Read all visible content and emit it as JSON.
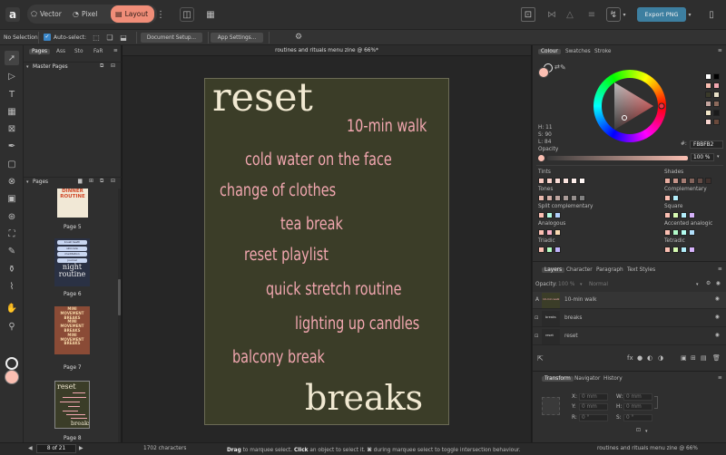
{
  "app": {
    "logo_letter": "a"
  },
  "personas": [
    {
      "label": "Vector",
      "active": false
    },
    {
      "label": "Pixel",
      "active": false
    },
    {
      "label": "Layout",
      "active": true
    }
  ],
  "export_label": "Export PNG",
  "context": {
    "selection": "No Selection",
    "auto_select": "Auto-select:",
    "document_setup": "Document Setup...",
    "app_settings": "App Settings..."
  },
  "left_panel": {
    "tabs": [
      "Pages",
      "Ass",
      "Sto",
      "FaR"
    ],
    "master_pages_title": "Master Pages",
    "pages_title": "Pages",
    "pages": [
      {
        "label": "Page 5",
        "thumb_lines": [
          "DINNER",
          "ROUTINE"
        ]
      },
      {
        "label": "Page 6",
        "thumb_lines": [
          "brush teeth",
          "skincare",
          "meditation",
          "journal",
          "night",
          "routine"
        ]
      },
      {
        "label": "Page 7",
        "thumb_lines": [
          "MINI",
          "MOVEMENT",
          "BREAKS",
          "MINI",
          "MOVEMENT",
          "BREAKS",
          "MINI",
          "MOVEMENT",
          "BREAKS"
        ]
      },
      {
        "label": "Page 8",
        "thumb_lines": [
          "reset",
          "breaks"
        ]
      }
    ]
  },
  "document": {
    "title": "routines and rituals menu zine @ 66%*",
    "heading": "reset",
    "lines": [
      "10-min walk",
      "cold water on the face",
      "change of clothes",
      "tea break",
      "reset playlist",
      "quick stretch routine",
      "lighting up candles",
      "balcony break"
    ],
    "footer": "breaks"
  },
  "colour_panel": {
    "tabs": [
      "Colour",
      "Swatches",
      "Stroke"
    ],
    "hsl": [
      "H: 11",
      "S: 90",
      "L: 84"
    ],
    "hex_label": "#:",
    "hex_value": "FBBFB2",
    "opacity_label": "Opacity",
    "opacity_value": "100 %",
    "fill_color": "#fbbfb2",
    "groups": [
      {
        "label": "Tints",
        "colors": [
          "#f6c9c0",
          "#f8d2cb",
          "#f9dbd5",
          "#fbe4df",
          "#fcedea",
          "#fef6f4"
        ]
      },
      {
        "label": "Shades",
        "colors": [
          "#e7ada0",
          "#c6958a",
          "#a57c73",
          "#84645c",
          "#634b45",
          "#42322e"
        ]
      },
      {
        "label": "Tones",
        "colors": [
          "#e8b8ad",
          "#d3aea6",
          "#bea59f",
          "#a99b98",
          "#958f8d",
          "#808080"
        ]
      },
      {
        "label": "Complementary",
        "colors": [
          "#fbbfb2",
          "#b2eefb"
        ]
      },
      {
        "label": "Split complementary",
        "colors": [
          "#fbbfb2",
          "#b2fbe1",
          "#b2cffb"
        ]
      },
      {
        "label": "Square",
        "colors": [
          "#fbbfb2",
          "#d7fbb2",
          "#b2eefb",
          "#d6b2fb"
        ]
      },
      {
        "label": "Analogous",
        "colors": [
          "#fbbfb2",
          "#fbb2c7",
          "#fbdab2"
        ]
      },
      {
        "label": "Accented analogic",
        "colors": [
          "#fbbfb2",
          "#b2fbc9",
          "#b2fbee",
          "#b2dffb"
        ]
      },
      {
        "label": "Triadic",
        "colors": [
          "#fbbfb2",
          "#b2fbbf",
          "#bfb2fb"
        ]
      },
      {
        "label": "Tetradic",
        "colors": [
          "#fbbfb2",
          "#d7fbb2",
          "#b2eefb",
          "#d6b2fb"
        ]
      }
    ],
    "recent": [
      "#ffffff",
      "#000000",
      "#fbbfb2",
      "#f2a7b0",
      "#3a3a2a",
      "#e8e0c8",
      "#c4a59f",
      "#8c6a5c",
      "#f2e6c8",
      "#1a1a1a",
      "#f9d5d0",
      "#6b4a3c"
    ]
  },
  "layers_panel": {
    "tabs": [
      "Layers",
      "Character",
      "Paragraph",
      "Text Styles"
    ],
    "opacity_label": "Opacity:",
    "opacity_value": "100 %",
    "blend": "Normal",
    "layers": [
      {
        "name": "10-min walk",
        "thumb": "10-min walk"
      },
      {
        "name": "breaks",
        "thumb": "breaks"
      },
      {
        "name": "reset",
        "thumb": "reset"
      }
    ]
  },
  "transform_panel": {
    "tabs": [
      "Transform",
      "Navigator",
      "History"
    ],
    "fields": [
      {
        "label": "X:",
        "value": "0 mm"
      },
      {
        "label": "W:",
        "value": "0 mm"
      },
      {
        "label": "Y:",
        "value": "0 mm"
      },
      {
        "label": "H:",
        "value": "0 mm"
      },
      {
        "label": "R:",
        "value": "0 °"
      },
      {
        "label": "S:",
        "value": "0 °"
      }
    ]
  },
  "status": {
    "page_indicator": "8 of 21",
    "characters": "1702 characters",
    "hint_1": "Drag",
    "hint_2": " to marquee select. ",
    "hint_3": "Click",
    "hint_4": " an object to select it. ",
    "hint_5": "⌘",
    "hint_6": " during marquee select to toggle intersection behaviour.",
    "doc_title": "routines and rituals menu zine @ 66%"
  }
}
